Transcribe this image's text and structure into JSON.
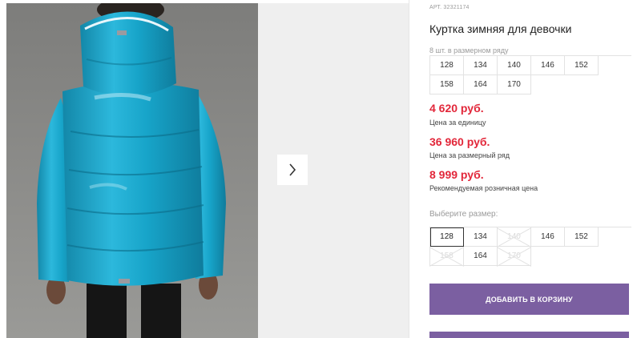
{
  "product": {
    "sku": "АРТ. 32321174",
    "title": "Куртка зимняя для девочки",
    "row_note": "8 шт. в размерном ряду",
    "row_sizes": [
      "128",
      "134",
      "140",
      "146",
      "152",
      "158",
      "164",
      "170"
    ],
    "prices": [
      {
        "value": "4 620 руб.",
        "caption": "Цена за единицу"
      },
      {
        "value": "36 960 руб.",
        "caption": "Цена за размерный ряд"
      },
      {
        "value": "8 999 руб.",
        "caption": "Рекомендуемая розничная цена"
      }
    ],
    "choose_label": "Выберите размер:",
    "size_options": [
      {
        "label": "128",
        "state": "selected"
      },
      {
        "label": "134",
        "state": "available"
      },
      {
        "label": "140",
        "state": "disabled"
      },
      {
        "label": "146",
        "state": "available"
      },
      {
        "label": "152",
        "state": "available"
      },
      {
        "label": "158",
        "state": "disabled"
      },
      {
        "label": "164",
        "state": "available"
      },
      {
        "label": "170",
        "state": "disabled"
      }
    ],
    "cart_button": "ДОБАВИТЬ В КОРЗИНУ"
  },
  "gallery": {
    "next_icon": "chevron-right-icon",
    "jacket_color": "#1aa3c6",
    "accent_color": "#7b5fa1",
    "price_color": "#e2273a"
  }
}
